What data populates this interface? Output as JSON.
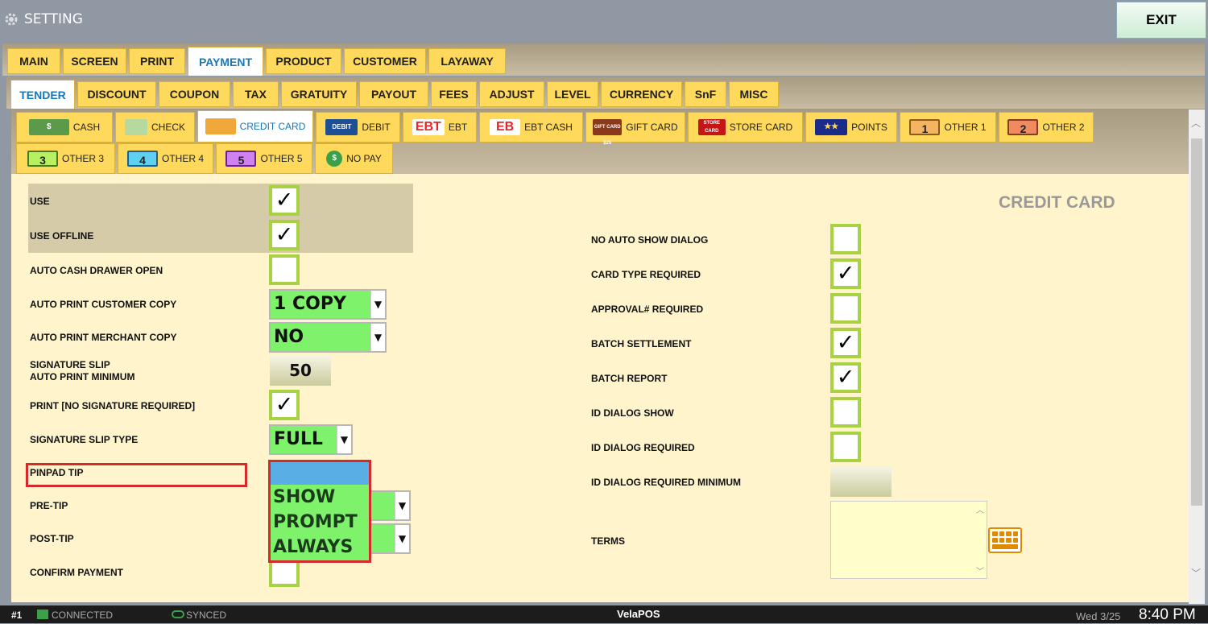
{
  "title": "SETTING",
  "exit_label": "EXIT",
  "tabs_level1": [
    {
      "label": "MAIN"
    },
    {
      "label": "SCREEN"
    },
    {
      "label": "PRINT"
    },
    {
      "label": "PAYMENT"
    },
    {
      "label": "PRODUCT"
    },
    {
      "label": "CUSTOMER"
    },
    {
      "label": "LAYAWAY"
    }
  ],
  "tabs_level2": [
    {
      "label": "TENDER"
    },
    {
      "label": "DISCOUNT"
    },
    {
      "label": "COUPON"
    },
    {
      "label": "TAX"
    },
    {
      "label": "GRATUITY"
    },
    {
      "label": "PAYOUT"
    },
    {
      "label": "FEES"
    },
    {
      "label": "ADJUST"
    },
    {
      "label": "LEVEL"
    },
    {
      "label": "CURRENCY"
    },
    {
      "label": "SnF"
    },
    {
      "label": "MISC"
    }
  ],
  "tabs_level3": [
    {
      "label": "CASH",
      "icon": "cash-icon"
    },
    {
      "label": "CHECK",
      "icon": "check-icon"
    },
    {
      "label": "CREDIT CARD",
      "icon": "credit-card-icon"
    },
    {
      "label": "DEBIT",
      "icon": "debit-card-icon",
      "icon_text": "DEBIT"
    },
    {
      "label": "EBT",
      "icon": "ebt-icon",
      "icon_text": "EBT"
    },
    {
      "label": "EBT CASH",
      "icon": "ebt-cash-icon",
      "icon_text": "EB"
    },
    {
      "label": "GIFT CARD",
      "icon": "gift-card-icon",
      "icon_text": "GIFT CARD $25"
    },
    {
      "label": "STORE CARD",
      "icon": "store-card-icon",
      "icon_text": "STORE CARD"
    },
    {
      "label": "POINTS",
      "icon": "points-icon"
    },
    {
      "label": "OTHER 1",
      "icon": "ticket-1-icon",
      "icon_text": "1"
    },
    {
      "label": "OTHER 2",
      "icon": "ticket-2-icon",
      "icon_text": "2"
    },
    {
      "label": "OTHER 3",
      "icon": "ticket-3-icon",
      "icon_text": "3"
    },
    {
      "label": "OTHER 4",
      "icon": "ticket-4-icon",
      "icon_text": "4"
    },
    {
      "label": "OTHER 5",
      "icon": "ticket-5-icon",
      "icon_text": "5"
    },
    {
      "label": "NO PAY",
      "icon": "no-pay-icon"
    }
  ],
  "section_title": "CREDIT CARD",
  "left": {
    "use": "USE",
    "use_offline": "USE OFFLINE",
    "auto_cash_drawer": "AUTO CASH DRAWER OPEN",
    "auto_print_customer": "AUTO PRINT CUSTOMER COPY",
    "auto_print_customer_value": "1 COPY",
    "auto_print_merchant": "AUTO PRINT MERCHANT COPY",
    "auto_print_merchant_value": "NO",
    "sig_slip_line1": "SIGNATURE SLIP",
    "sig_slip_line2": "AUTO PRINT MINIMUM",
    "sig_slip_min_value": "50",
    "print_no_sig": "PRINT [NO SIGNATURE REQUIRED]",
    "sig_slip_type": "SIGNATURE SLIP TYPE",
    "sig_slip_type_value": "FULL",
    "pinpad_tip": "PINPAD TIP",
    "pre_tip": "PRE-TIP",
    "post_tip": "POST-TIP",
    "confirm_payment": "CONFIRM PAYMENT",
    "dropdown_options": [
      "SHOW",
      "PROMPT",
      "ALWAYS"
    ]
  },
  "right": {
    "no_auto_show": "NO AUTO SHOW DIALOG",
    "card_type_req": "CARD TYPE REQUIRED",
    "approval_req": "APPROVAL# REQUIRED",
    "batch_settlement": "BATCH SETTLEMENT",
    "batch_report": "BATCH REPORT",
    "id_dialog_show": "ID DIALOG SHOW",
    "id_dialog_req": "ID DIALOG REQUIRED",
    "id_dialog_req_min": "ID DIALOG REQUIRED MINIMUM",
    "terms": "TERMS"
  },
  "checks": {
    "use": true,
    "use_offline": true,
    "auto_cash_drawer": false,
    "print_no_sig": true,
    "confirm_payment": false,
    "no_auto_show": false,
    "card_type_req": true,
    "approval_req": false,
    "batch_settlement": true,
    "batch_report": true,
    "id_dialog_show": false,
    "id_dialog_req": false
  },
  "status": {
    "station": "#1",
    "connected": "CONNECTED",
    "synced": "SYNCED",
    "brand_a": "Vela",
    "brand_b": "POS",
    "date": "Wed 3/25",
    "time": "8:40 PM"
  },
  "colors": {
    "tab": "#ffd95c",
    "active_text": "#1877b8",
    "select_green": "#7ff26b",
    "highlight_red": "#d42a2a"
  }
}
